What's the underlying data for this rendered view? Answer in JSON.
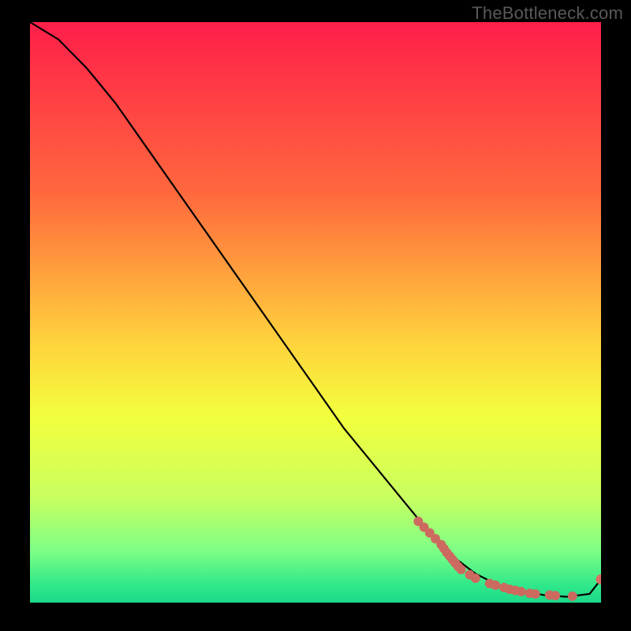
{
  "watermark": "TheBottleneck.com",
  "chart_data": {
    "type": "line",
    "title": "",
    "xlabel": "",
    "ylabel": "",
    "xlim": [
      0,
      100
    ],
    "ylim": [
      0,
      100
    ],
    "grid": false,
    "legend": false,
    "background_gradient_top": "#ff1e4a",
    "background_gradient_bottom": "#1cd98a",
    "series": [
      {
        "name": "bottleneck-curve",
        "color": "#000000",
        "x": [
          0,
          5,
          10,
          15,
          20,
          25,
          30,
          35,
          40,
          45,
          50,
          55,
          60,
          65,
          70,
          74,
          78,
          82,
          86,
          90,
          94,
          98,
          100
        ],
        "y": [
          100,
          97,
          92,
          86,
          79,
          72,
          65,
          58,
          51,
          44,
          37,
          30,
          24,
          18,
          12,
          8,
          5,
          3,
          2,
          1.3,
          1,
          1.5,
          4
        ]
      }
    ],
    "scatter_points": {
      "name": "highlighted-points",
      "color": "#cc6a60",
      "x": [
        68,
        69,
        70,
        71,
        72,
        72.5,
        73,
        73.5,
        74,
        74.5,
        75,
        75.5,
        77,
        78,
        80.5,
        81.5,
        83,
        84,
        85,
        86,
        87.5,
        88.5,
        91,
        92,
        95,
        100
      ],
      "y": [
        14,
        13,
        12,
        11,
        10,
        9.3,
        8.6,
        8,
        7.4,
        6.8,
        6.2,
        5.7,
        4.8,
        4.2,
        3.3,
        3.0,
        2.6,
        2.3,
        2.1,
        1.9,
        1.6,
        1.5,
        1.3,
        1.2,
        1.1,
        4
      ]
    }
  }
}
